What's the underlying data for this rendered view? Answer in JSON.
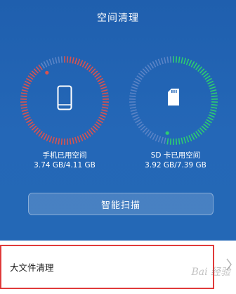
{
  "header": {
    "title": "空间清理"
  },
  "phone_storage": {
    "label": "手机已用空间",
    "value": "3.74 GB/4.11 GB",
    "used_fraction": 0.91,
    "accent_color": "#d9534f",
    "icon": "phone-icon"
  },
  "sd_storage": {
    "label": "SD 卡已用空间",
    "value": "3.92 GB/7.39 GB",
    "used_fraction": 0.53,
    "accent_color": "#2ecc71",
    "icon": "sd-card-icon"
  },
  "scan_button": {
    "label": "智能扫描"
  },
  "list": {
    "items": [
      {
        "label": "大文件清理",
        "icon": "chevron-right-icon"
      }
    ]
  },
  "watermark": {
    "text": "Bai 经验"
  },
  "colors": {
    "background": "#2467b7",
    "track": "#5b84c6",
    "highlight_border": "#e03a3a"
  }
}
